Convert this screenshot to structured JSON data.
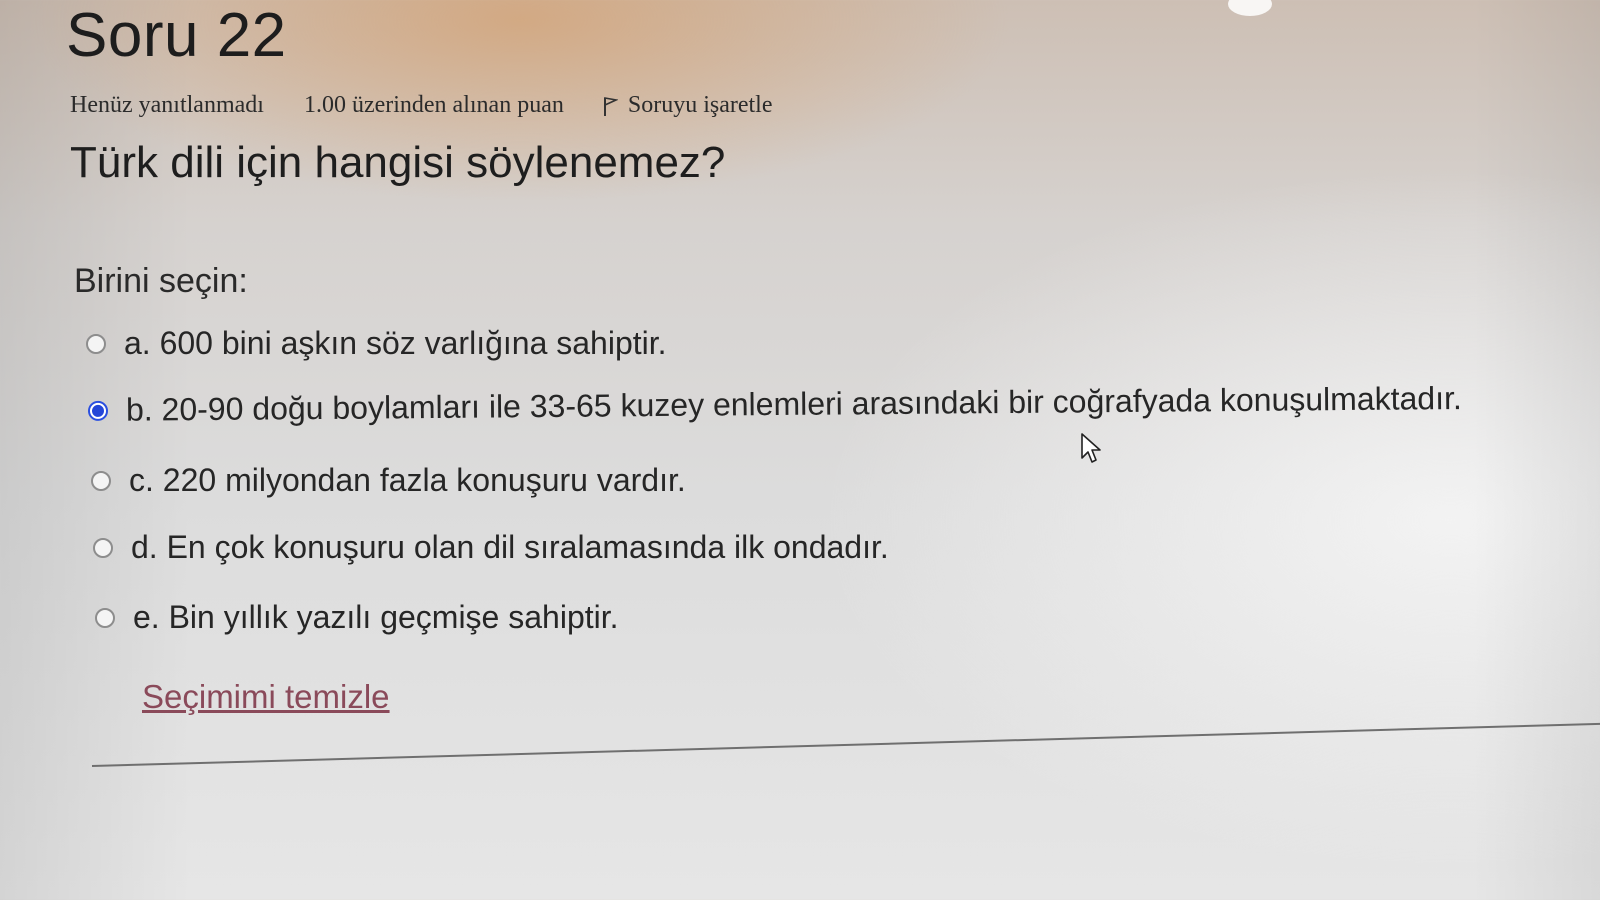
{
  "question": {
    "title": "Soru 22",
    "state": "Henüz yanıtlanmadı",
    "grade": "1.00 üzerinden alınan puan",
    "flag_label": "Soruyu işaretle",
    "text": "Türk dili için hangisi söylenemez?",
    "prompt": "Birini seçin:",
    "options": [
      {
        "label": "a. 600 bini aşkın söz varlığına sahiptir.",
        "checked": false
      },
      {
        "label": "b. 20-90 doğu boylamları ile 33-65 kuzey enlemleri arasındaki bir coğrafyada konuşulmaktadır.",
        "checked": true
      },
      {
        "label": "c. 220 milyondan fazla konuşuru vardır.",
        "checked": false
      },
      {
        "label": "d. En çok konuşuru olan dil sıralamasında ilk ondadır.",
        "checked": false
      },
      {
        "label": "e. Bin yıllık yazılı geçmişe sahiptir.",
        "checked": false
      }
    ],
    "clear_label": "Seçimimi temizle"
  },
  "colors": {
    "radio_selected": "#2446d8",
    "link": "#8a4a5a"
  },
  "icons": {
    "flag": "flag-icon",
    "cursor": "mouse-pointer-icon"
  }
}
